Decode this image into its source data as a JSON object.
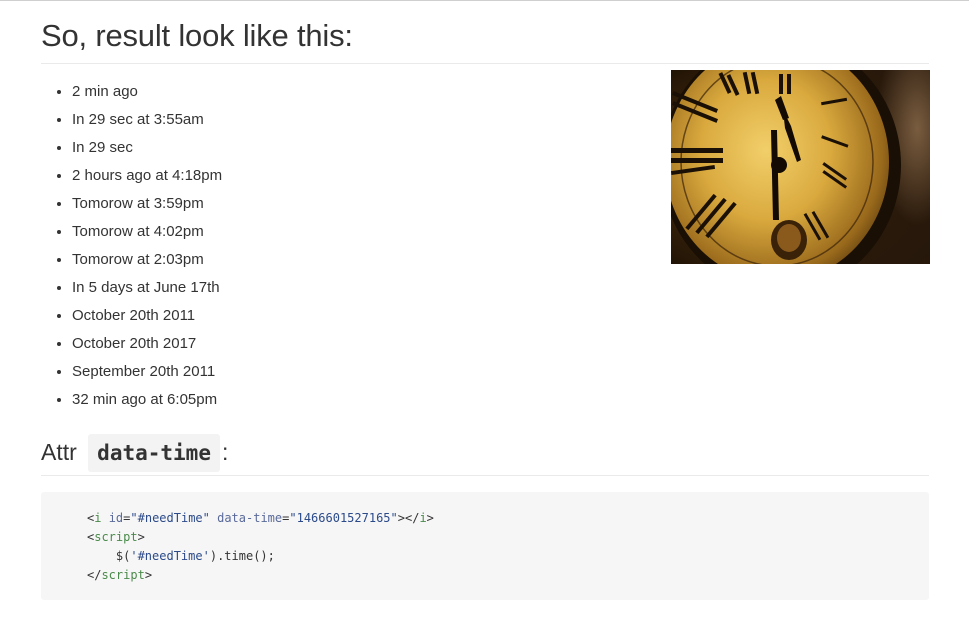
{
  "heading": "So, result look like this:",
  "times": [
    "2 min ago",
    "In 29 sec at 3:55am",
    "In 29 sec",
    "2 hours ago at 4:18pm",
    "Tomorow at 3:59pm",
    "Tomorow at 4:02pm",
    "Tomorow at 2:03pm",
    "In 5 days at June 17th",
    "October 20th 2011",
    "October 20th 2017",
    "September 20th 2011",
    "32 min ago at 6:05pm"
  ],
  "attr_heading": {
    "prefix": "Attr",
    "code": "data-time",
    "suffix": ":"
  },
  "code": {
    "line1": {
      "open": "<",
      "tag": "i",
      "attr1": "id",
      "eq1": "=",
      "val1": "\"#needTime\"",
      "attr2": "data-time",
      "eq2": "=",
      "val2": "\"1466601527165\"",
      "close": "></",
      "tag_close": "i",
      "end": ">"
    },
    "line2": {
      "open": "<",
      "tag": "script",
      "end": ">"
    },
    "line3": {
      "fn": "$(",
      "str": "'#needTime'",
      "rest": ").time();"
    },
    "line4": {
      "open": "</",
      "tag": "script",
      "end": ">"
    }
  }
}
